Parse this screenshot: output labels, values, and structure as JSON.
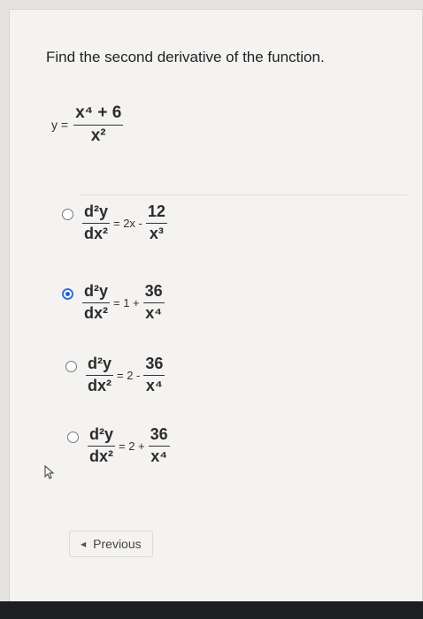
{
  "question": "Find the second derivative of the function.",
  "function": {
    "lhs": "y =",
    "numerator": "x⁴ + 6",
    "denominator": "x²"
  },
  "options": [
    {
      "num": "d²y",
      "den": "dx²",
      "mid": "= 2x -",
      "rnum": "12",
      "rden": "x³",
      "selected": false
    },
    {
      "num": "d²y",
      "den": "dx²",
      "mid": "= 1 +",
      "rnum": "36",
      "rden": "x⁴",
      "selected": true
    },
    {
      "num": "d²y",
      "den": "dx²",
      "mid": "= 2 -",
      "rnum": "36",
      "rden": "x⁴",
      "selected": false
    },
    {
      "num": "d²y",
      "den": "dx²",
      "mid": "= 2 +",
      "rnum": "36",
      "rden": "x⁴",
      "selected": false
    }
  ],
  "nav": {
    "previous": "Previous"
  },
  "colors": {
    "accent": "#1f5fd0",
    "background": "#f4f3f1"
  },
  "icons": {
    "previous": "triangle-left-icon",
    "cursor": "mouse-pointer-icon"
  }
}
